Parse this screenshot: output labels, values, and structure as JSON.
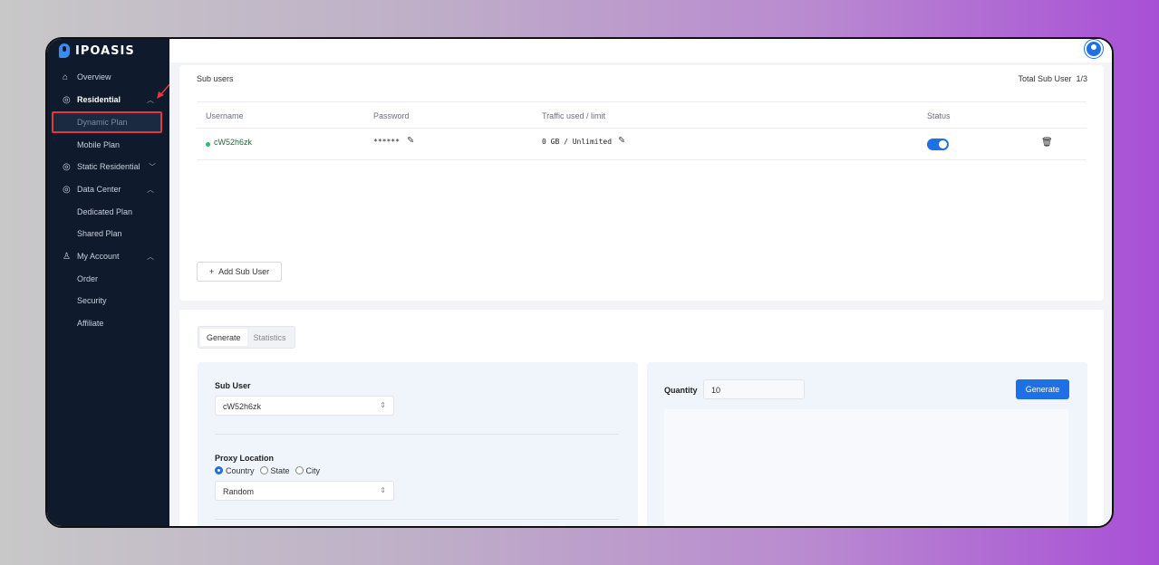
{
  "brand": {
    "name": "IPOASIS"
  },
  "sidebar": {
    "items": [
      {
        "label": "Overview",
        "icon": "home-icon"
      },
      {
        "label": "Residential",
        "icon": "globe-icon",
        "chevron": "^"
      },
      {
        "label": "Dynamic Plan"
      },
      {
        "label": "Mobile Plan"
      },
      {
        "label": "Static Residential",
        "icon": "globe-icon",
        "chevron": "v"
      },
      {
        "label": "Data Center",
        "icon": "globe-icon",
        "chevron": "^"
      },
      {
        "label": "Dedicated Plan"
      },
      {
        "label": "Shared Plan"
      },
      {
        "label": "My Account",
        "icon": "user-icon",
        "chevron": "^"
      },
      {
        "label": "Order"
      },
      {
        "label": "Security"
      },
      {
        "label": "Affiliate"
      }
    ]
  },
  "subusers": {
    "title": "Sub users",
    "total_label": "Total Sub User",
    "total_value": "1/3",
    "columns": [
      "Username",
      "Password",
      "Traffic used / limit",
      "Status"
    ],
    "rows": [
      {
        "username": "cW52h6zk",
        "password": "******",
        "traffic": "0 GB / Unlimited",
        "status": "on"
      }
    ],
    "add_button": "Add Sub User"
  },
  "generator": {
    "tabs": [
      "Generate",
      "Statistics"
    ],
    "sub_user_label": "Sub User",
    "sub_user_value": "cW52h6zk",
    "proxy_location_label": "Proxy Location",
    "location_options": [
      "Country",
      "State",
      "City"
    ],
    "location_selected": "Country",
    "location_value": "Random",
    "quantity_label": "Quantity",
    "quantity_value": "10",
    "generate_button": "Generate"
  },
  "colors": {
    "accent": "#1f6fe5",
    "sidebar_bg": "#0f1b2d",
    "highlight": "#e5383b"
  }
}
